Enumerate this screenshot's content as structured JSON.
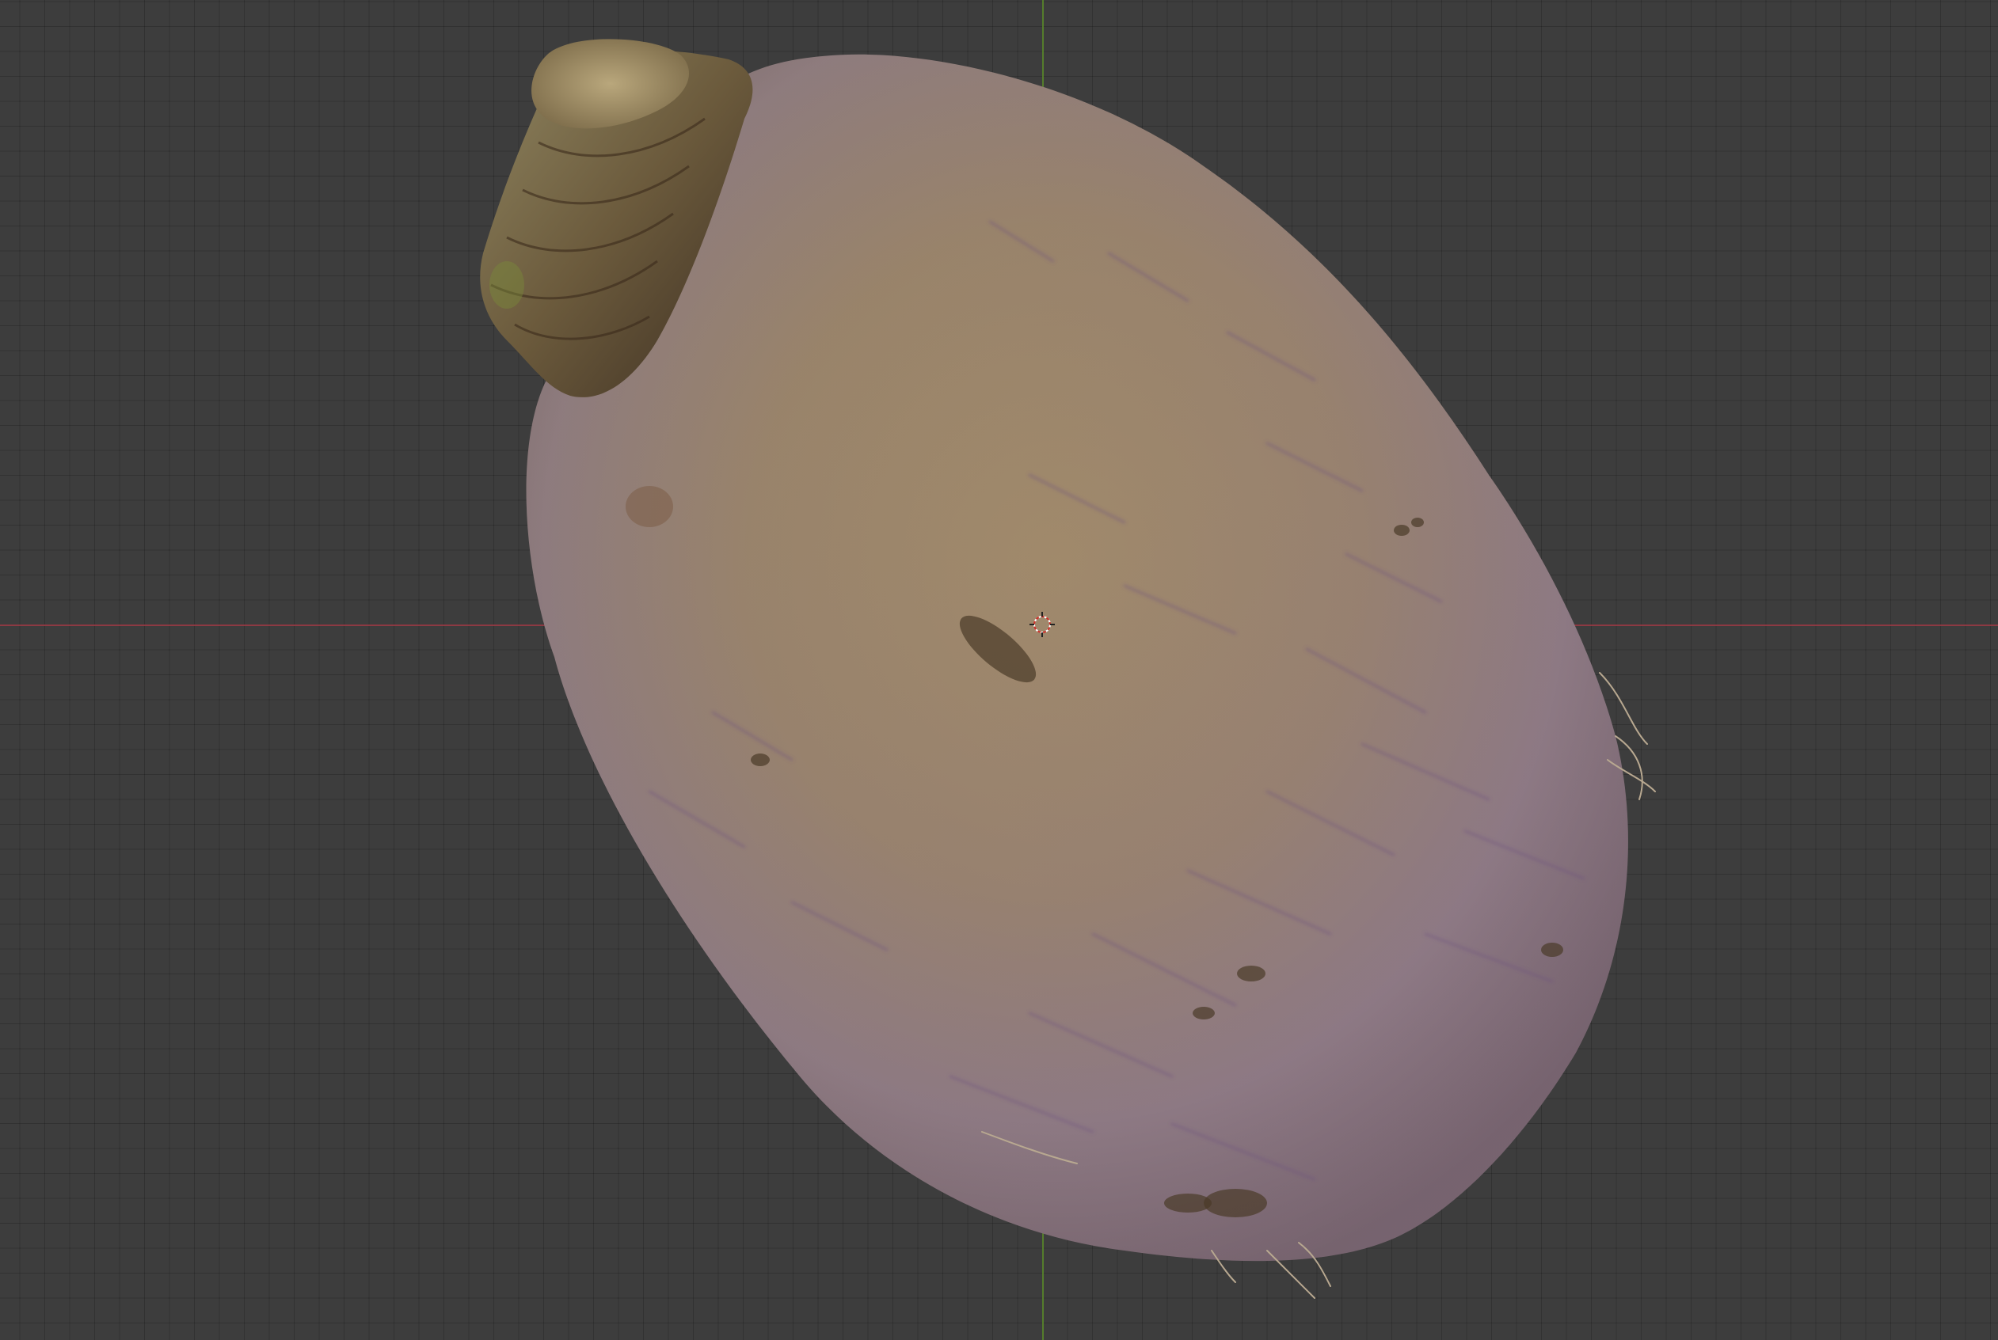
{
  "viewport": {
    "background_color": "#3d3d3d",
    "grid_line_color": "#353535",
    "axis_x_color": "#9a3a44",
    "axis_y_color": "#5a8a2a"
  },
  "scene": {
    "object_icon": "turnip-mesh",
    "cursor_icon": "3d-cursor-icon"
  }
}
